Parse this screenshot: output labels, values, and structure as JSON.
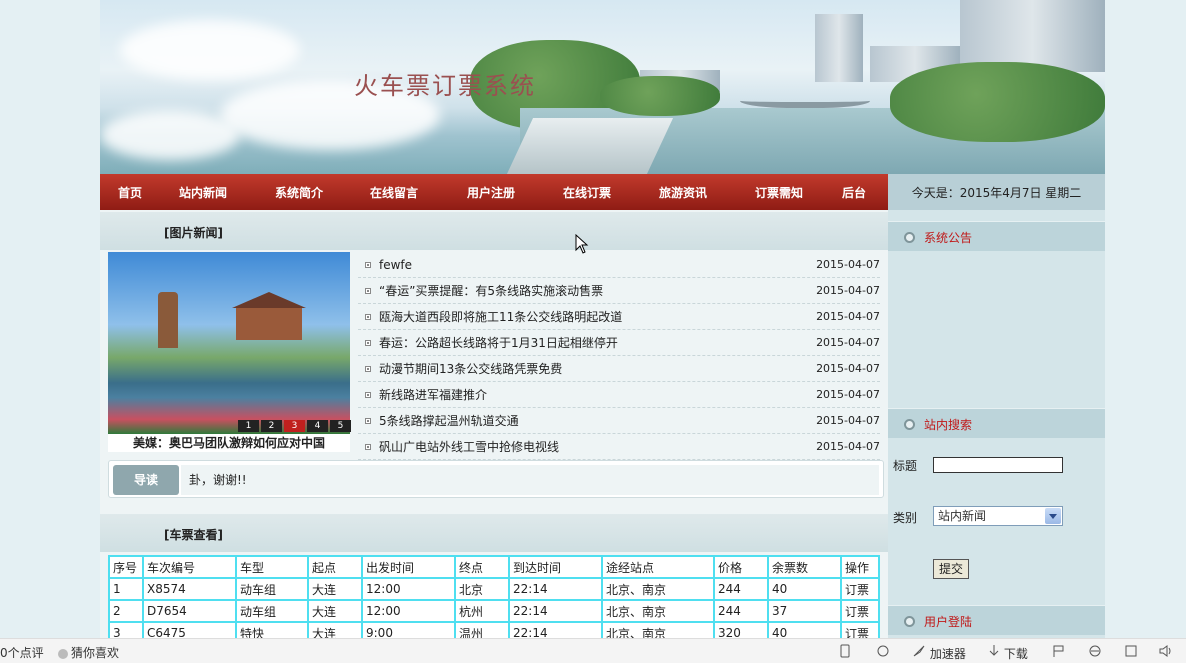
{
  "banner": {
    "title": "火车票订票系统"
  },
  "nav": {
    "items": [
      "首页",
      "站内新闻",
      "系统简介",
      "在线留言",
      "用户注册",
      "在线订票",
      "旅游资讯",
      "订票需知",
      "后台"
    ],
    "date_text": "今天是：2015年4月7日 星期二"
  },
  "photo_news": {
    "heading": "[图片新闻]",
    "caption": "美媒：奥巴马团队激辩如何应对中国",
    "pages": [
      "1",
      "2",
      "3",
      "4",
      "5"
    ],
    "active_page": 3
  },
  "news": [
    {
      "title": "fewfe",
      "date": "2015-04-07"
    },
    {
      "title": "“春运”买票提醒：有5条线路实施滚动售票",
      "date": "2015-04-07"
    },
    {
      "title": "瓯海大道西段即将施工11条公交线路明起改道",
      "date": "2015-04-07"
    },
    {
      "title": "春运：公路超长线路将于1月31日起相继停开",
      "date": "2015-04-07"
    },
    {
      "title": "动漫节期间13条公交线路凭票免费",
      "date": "2015-04-07"
    },
    {
      "title": "新线路进军福建推介",
      "date": "2015-04-07"
    },
    {
      "title": "5条线路撑起温州轨道交通",
      "date": "2015-04-07"
    },
    {
      "title": "矾山广电站外线工雪中抢修电视线",
      "date": "2015-04-07"
    }
  ],
  "guide": {
    "button": "导读",
    "text": "卦，谢谢!!"
  },
  "tickets": {
    "heading": "[车票查看]",
    "columns": [
      "序号",
      "车次编号",
      "车型",
      "起点",
      "出发时间",
      "终点",
      "到达时间",
      "途经站点",
      "价格",
      "余票数",
      "操作"
    ],
    "rows": [
      [
        "1",
        "X8574",
        "动车组",
        "大连",
        "12:00",
        "北京",
        "22:14",
        "北京、南京",
        "244",
        "40",
        "订票"
      ],
      [
        "2",
        "D7654",
        "动车组",
        "大连",
        "12:00",
        "杭州",
        "22:14",
        "北京、南京",
        "244",
        "37",
        "订票"
      ],
      [
        "3",
        "C6475",
        "特快",
        "大连",
        "9:00",
        "温州",
        "22:14",
        "北京、南京",
        "320",
        "40",
        "订票"
      ]
    ]
  },
  "sidebar": {
    "notice_title": "系统公告",
    "search_title": "站内搜索",
    "title_label": "标题",
    "category_label": "类别",
    "category_value": "站内新闻",
    "submit_label": "提交",
    "login_title": "用户登陆"
  },
  "statusbar": {
    "left1": "0个点评",
    "left2": "猜你喜欢",
    "accelerator": "加速器",
    "download": "下载"
  }
}
